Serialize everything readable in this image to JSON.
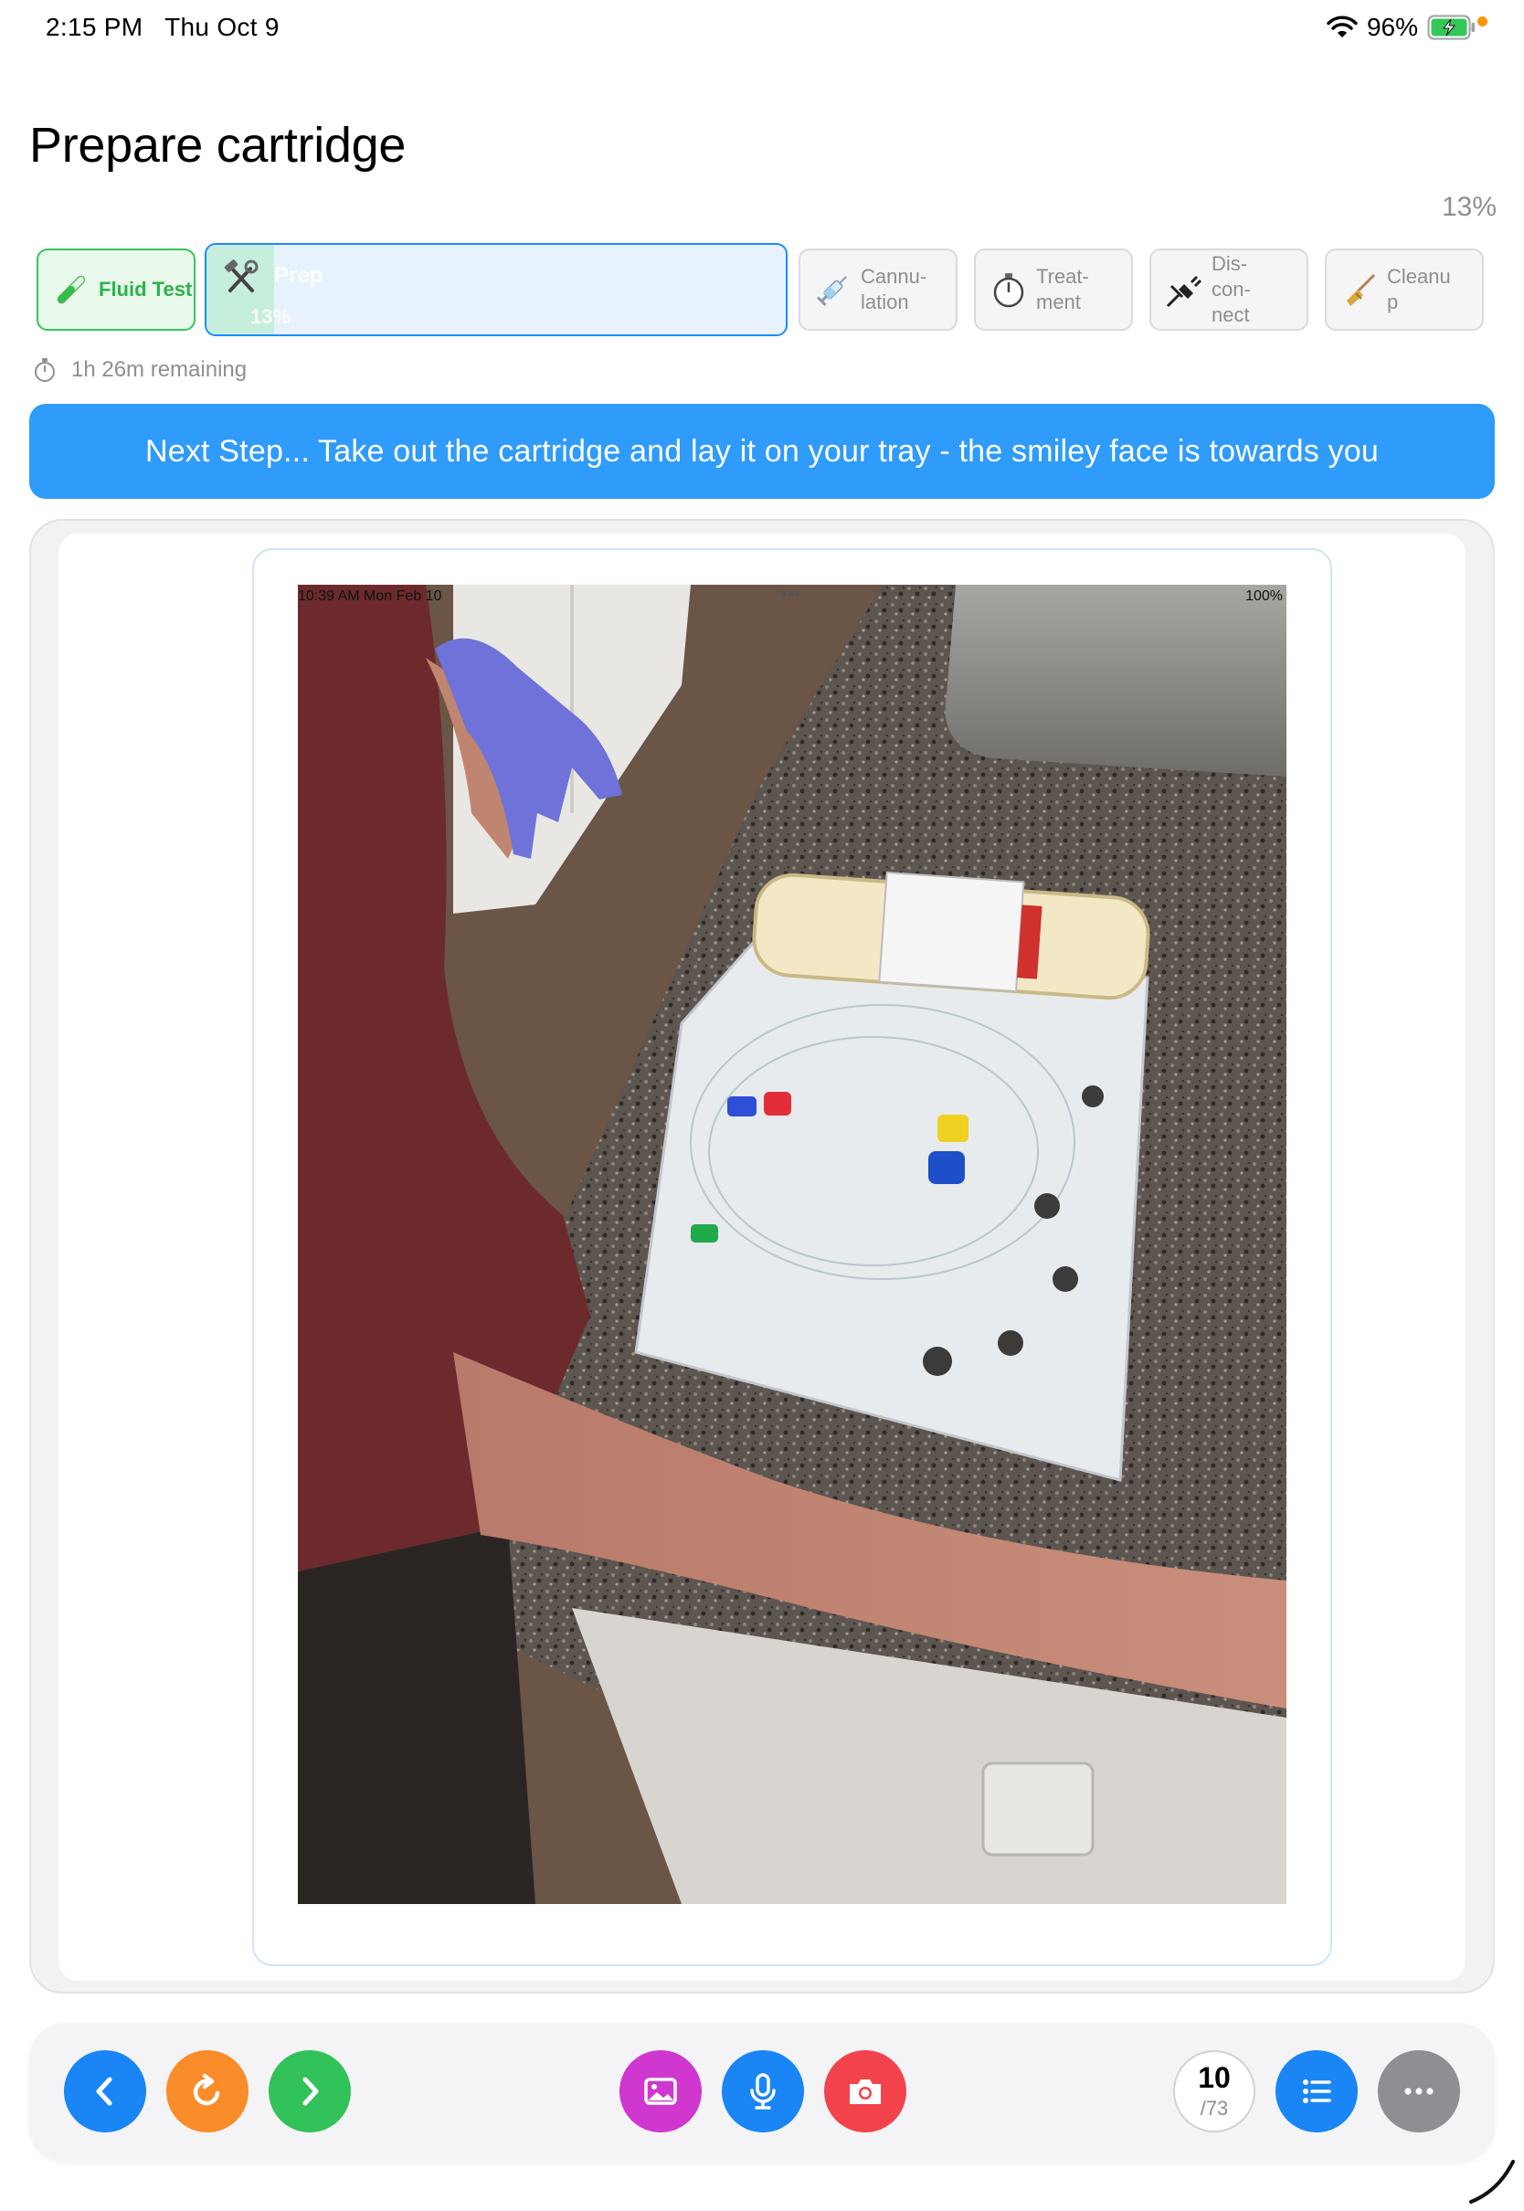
{
  "status_bar": {
    "time": "2:15 PM",
    "date": "Thu Oct 9",
    "battery": "96%",
    "wifi_icon": "wifi-icon",
    "battery_icon": "battery-charging-icon"
  },
  "page": {
    "title": "Prepare cartridge",
    "overall_percent": "13%"
  },
  "steps": [
    {
      "label": "Fluid Test",
      "state": "done",
      "icon": "test-tube-icon"
    },
    {
      "label": "Prep",
      "state": "active",
      "progress": 13,
      "progress_label": "13%",
      "icon": "hammer-wrench-icon"
    },
    {
      "label": "Cannu-\nlation",
      "state": "pending",
      "icon": "syringe-icon"
    },
    {
      "label": "Treat-\nment",
      "state": "pending",
      "icon": "stopwatch-icon"
    },
    {
      "label": "Dis-\ncon-\nnect",
      "state": "pending",
      "icon": "unplug-icon"
    },
    {
      "label": "Cleanu\np",
      "state": "pending",
      "icon": "broom-icon"
    }
  ],
  "remaining": {
    "text": "1h 26m remaining",
    "icon": "stopwatch-icon"
  },
  "next_step": {
    "text": "Next Step... Take out the cartridge and lay it on your tray - the smiley face is towards you"
  },
  "photo": {
    "status_time": "10:39 AM   Mon Feb 10",
    "status_dots": "•••",
    "status_battery": "100%"
  },
  "toolbar": {
    "back_icon": "chevron-left-icon",
    "repeat_icon": "refresh-icon",
    "forward_icon": "chevron-right-icon",
    "gallery_icon": "photo-icon",
    "mic_icon": "microphone-icon",
    "camera_icon": "camera-icon",
    "current_step": "10",
    "total_steps": "/73",
    "list_icon": "list-icon",
    "more_icon": "more-icon"
  },
  "colors": {
    "accent": "#2f9bfb",
    "done": "#34c759",
    "orange": "#fa8c29",
    "magenta": "#cf37cf",
    "red": "#f2434d",
    "grey": "#8e8e93"
  }
}
